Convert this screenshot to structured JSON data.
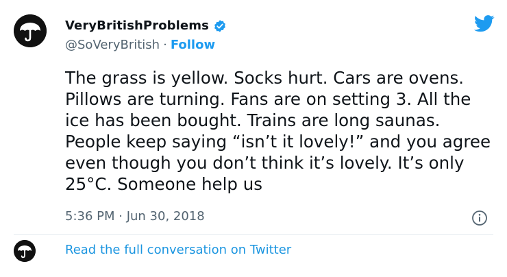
{
  "header": {
    "display_name": "VeryBritishProblems",
    "handle": "@SoVeryBritish",
    "separator": "·",
    "follow_label": "Follow"
  },
  "tweet": {
    "text": "The grass is yellow. Socks hurt. Cars are ovens. Pillows are turning. Fans are on setting 3. All the ice has been bought. Trains are long saunas. People keep saying “isn’t it lovely!” and you agree even though you don’t think it’s lovely. It’s only 25°C. Someone help us",
    "timestamp": "5:36 PM · Jun 30, 2018"
  },
  "footer": {
    "conversation_link": "Read the full conversation on Twitter"
  },
  "icons": {
    "avatar": "umbrella-avatar-icon",
    "verified": "verified-badge-icon",
    "brand": "twitter-bird-icon",
    "info": "info-icon"
  },
  "colors": {
    "accent": "#1d9bf0",
    "link": "#1b95e0",
    "text": "#0f1419",
    "muted": "#536471",
    "avatar_bg": "#111111"
  }
}
